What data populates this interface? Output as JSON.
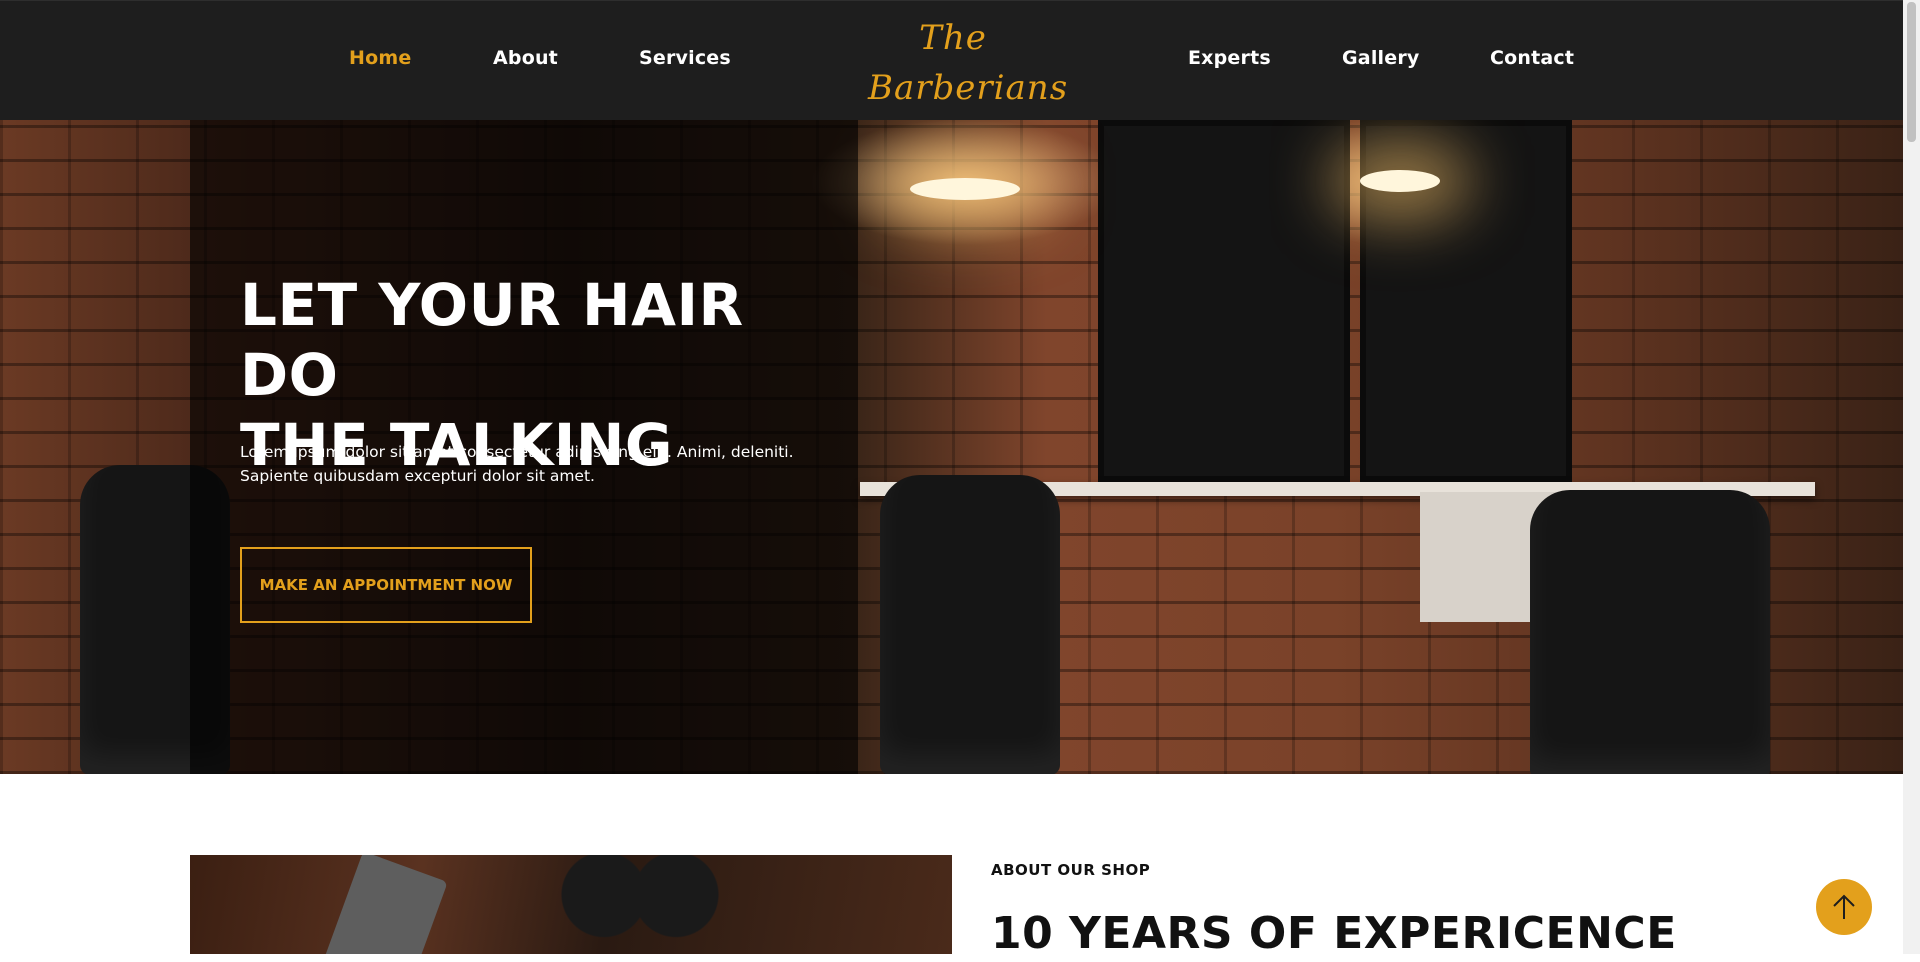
{
  "nav": {
    "links": [
      "Home",
      "About",
      "Services",
      "Experts",
      "Gallery",
      "Contact"
    ],
    "active": "Home",
    "logo_line1": "The",
    "logo_line2": "Barberians"
  },
  "hero": {
    "title_line1": "LET YOUR HAIR DO",
    "title_line2": "THE TALKING",
    "text_line1": "Lorem ipsum dolor sit amet consectetur adipisicing elit. Animi, deleniti.",
    "text_line2": "Sapiente quibusdam excepturi dolor sit amet.",
    "cta_label": "MAKE AN APPOINTMENT NOW"
  },
  "about": {
    "eyebrow": "ABOUT OUR SHOP",
    "title": "10 YEARS OF EXPERICENCE"
  },
  "icons": {
    "scroll_top": "arrow-up-icon"
  },
  "colors": {
    "accent": "#e3a01c",
    "navbar_bg": "#1e1e1e",
    "text_light": "#ffffff",
    "text_dark": "#111111"
  }
}
